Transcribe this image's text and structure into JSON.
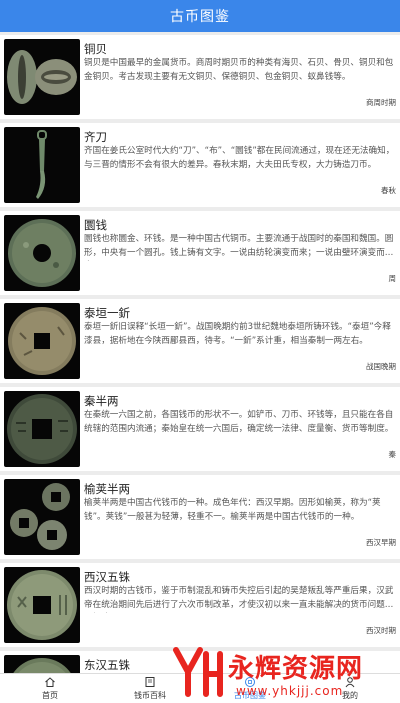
{
  "header": {
    "title": "古币图鉴"
  },
  "items": [
    {
      "name": "铜贝",
      "desc": "铜贝是中国最早的金属货币。商周时期贝币的种类有海贝、石贝、骨贝、铜贝和包金铜贝。考古发现主要有无文铜贝、保德铜贝、包金铜贝、蚁鼻钱等。",
      "period": "商周时期",
      "image": "shell-coins"
    },
    {
      "name": "齐刀",
      "desc": "齐国在姜氏公室时代大约“刀”、“布”、“圜钱”都在民间流通过，现在还无法确知，与三晋的情形不会有很大的差异。春秋末期，大夫田氏专权，大力铸造刀币。",
      "period": "春秋",
      "image": "knife-coin"
    },
    {
      "name": "圜钱",
      "desc": "圜钱也称圜金、环钱。是一种中国古代铜币。主要流通于战国时的秦国和魏国。圆形，中央有一个圆孔。钱上铸有文字。一说由纺轮演变而来；一说由璧环演变而来。",
      "period": "周",
      "image": "round-hole-coin"
    },
    {
      "name": "泰垣一釿",
      "desc": "泰垣一釿旧误释“长垣一釿”。战国晚期约前3世纪魏地泰垣所铸环钱。“泰垣”今释漆县，据析地在今陕西郿县西，待考。“一釿”系计重，相当秦制一两左右。",
      "period": "战国晚期",
      "image": "round-square-coin"
    },
    {
      "name": "秦半两",
      "desc": "在秦统一六国之前，各国钱币的形状不一。如铲币、刀币、环钱等，且只能在各自统辖的范围内流通；秦始皇在统一六国后，确定统一法律、度量衡、货币等制度。",
      "period": "秦",
      "image": "banliang-coin"
    },
    {
      "name": "榆荚半两",
      "desc": "榆荚半两是中国古代钱币的一种。成色年代：西汉早期。因形如榆荚，称为“荚钱”。荚钱”一般甚为轻薄，轻重不一。榆荚半两是中国古代钱币的一种。",
      "period": "西汉早期",
      "image": "yujia-coins"
    },
    {
      "name": "西汉五铢",
      "desc": "西汉时期的古钱币，鉴于币制混乱和铸币失控后引起的吴楚叛乱等严重后果，汉武帝在统治期间先后进行了六次币制改革，才使汉初以来一直未能解决的货币问题得以解决。",
      "period": "西汉时期",
      "image": "wuzhu-coin"
    },
    {
      "name": "东汉五铢",
      "desc": "",
      "period": "",
      "image": "eastern-han-coin"
    }
  ],
  "tabbar": [
    {
      "label": "首页",
      "icon": "home-icon",
      "active": false
    },
    {
      "label": "钱币百科",
      "icon": "book-icon",
      "active": false
    },
    {
      "label": "古币图鉴",
      "icon": "coin-catalog-icon",
      "active": true
    },
    {
      "label": "我的",
      "icon": "user-icon",
      "active": false
    }
  ],
  "watermark": {
    "name": "永辉资源网",
    "url": "www.yhkjjj.com"
  },
  "colors": {
    "accent": "#3a86ea",
    "watermark": "#e8251f"
  }
}
